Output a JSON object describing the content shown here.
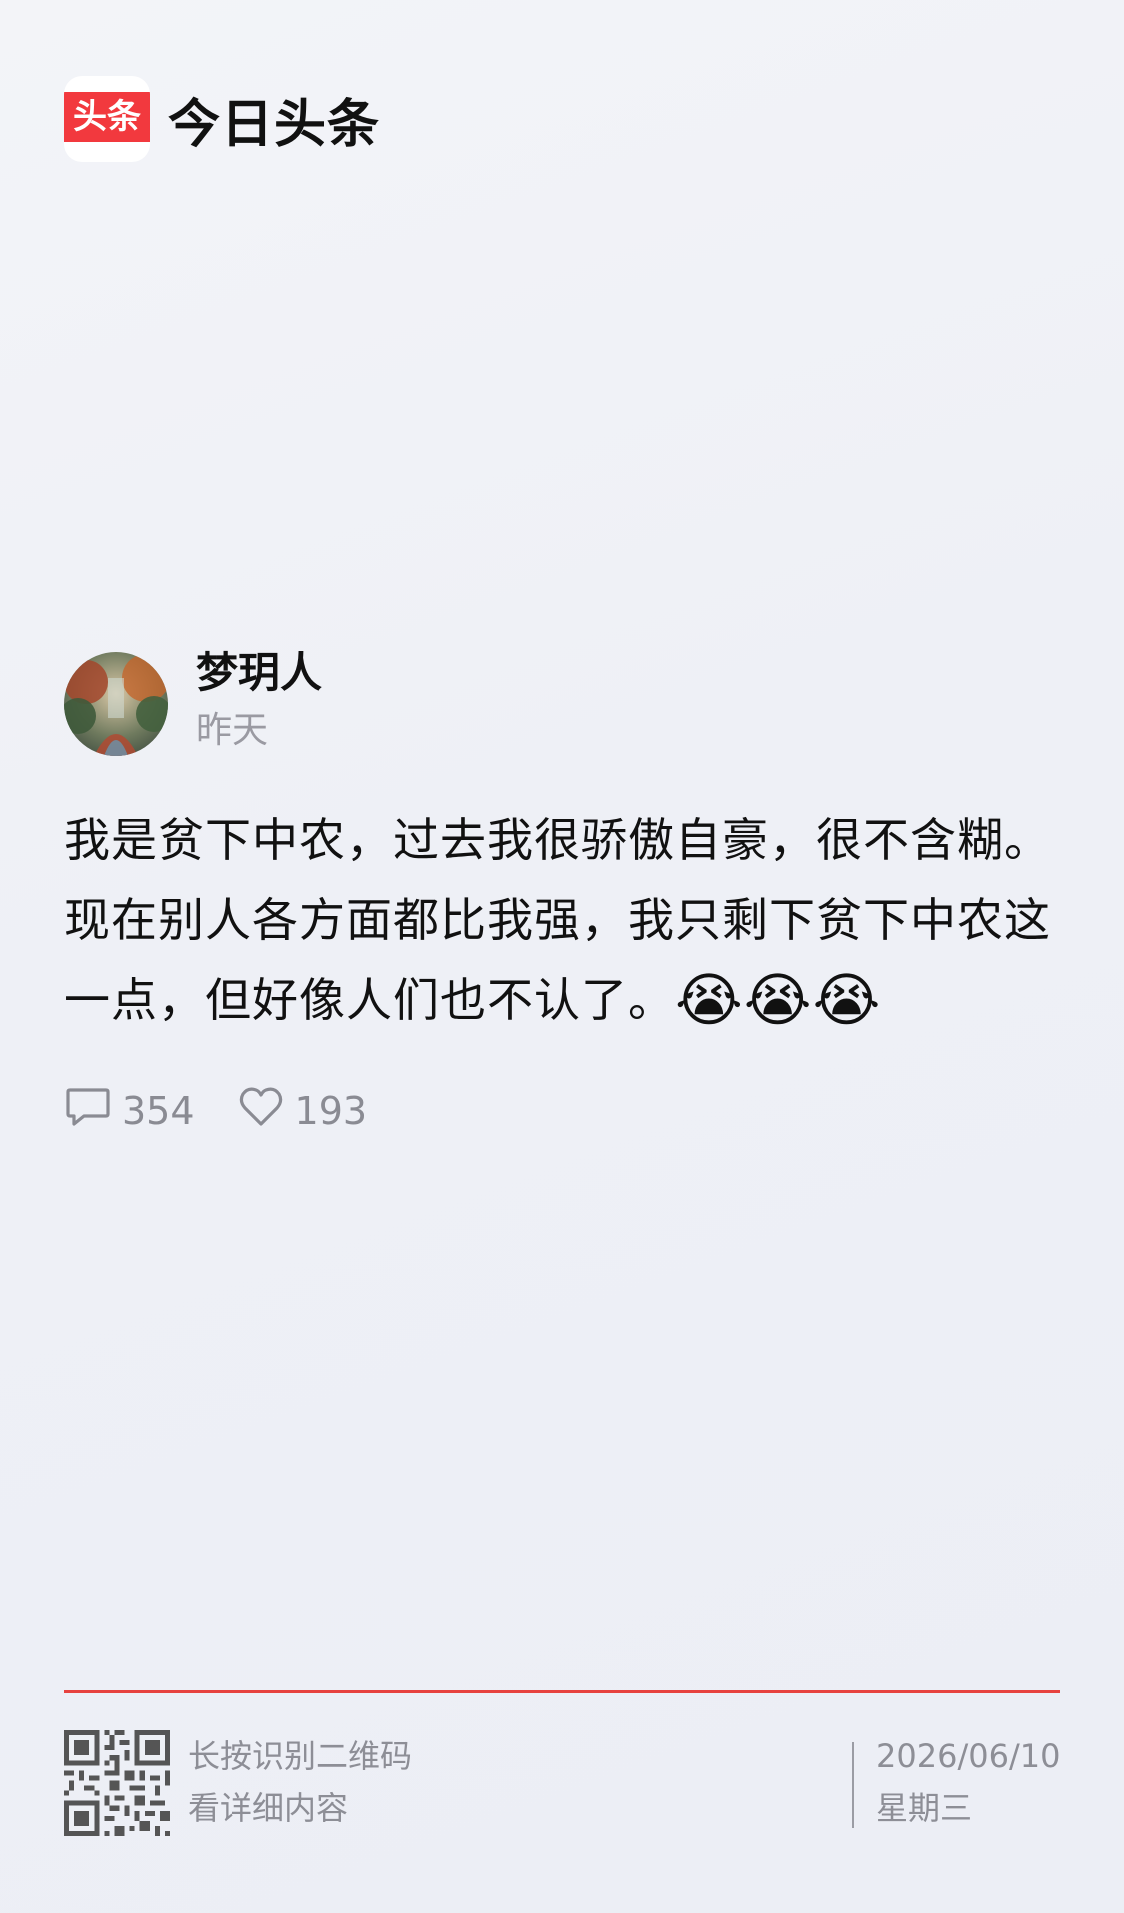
{
  "brand": {
    "logo_text": "头条",
    "app_name": "今日头条",
    "accent_color": "#f2393e"
  },
  "post": {
    "author_name": "梦玥人",
    "time": "昨天",
    "text": "我是贫下中农，过去我很骄傲自豪，很不含糊。现在别人各方面都比我强，我只剩下贫下中农这一点，但好像人们也不认了。",
    "emojis": [
      "😭",
      "😭",
      "😭"
    ],
    "comments_count": "354",
    "likes_count": "193",
    "icons": {
      "comment": "comment-icon",
      "like": "heart-icon"
    }
  },
  "footer": {
    "qr_line1": "长按识别二维码",
    "qr_line2": "看详细内容",
    "date": "2026/06/10",
    "weekday": "星期三",
    "divider_color": "#e7423f"
  }
}
